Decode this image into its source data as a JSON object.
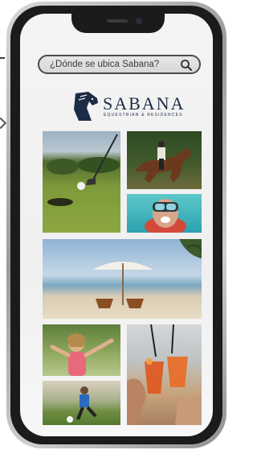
{
  "search": {
    "placeholder": "¿Dónde se ubica Sabana?",
    "icon": "search-icon"
  },
  "brand": {
    "name": "SABANA",
    "tagline": "EQUESTRIAN & RESIDENCES",
    "color": "#1c2c45",
    "icon": "horse-head-logo"
  },
  "gallery": {
    "photos": [
      "golf",
      "horse-riding",
      "snorkeling",
      "beach",
      "kids-playing",
      "soccer",
      "drinks"
    ]
  }
}
